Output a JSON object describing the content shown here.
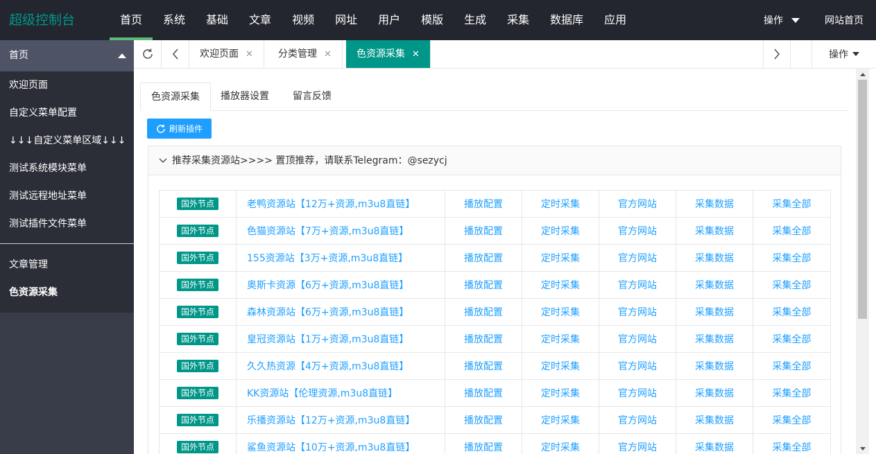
{
  "header": {
    "logo": "超级控制台",
    "nav": [
      "首页",
      "系统",
      "基础",
      "文章",
      "视频",
      "网址",
      "用户",
      "模版",
      "生成",
      "采集",
      "数据库",
      "应用"
    ],
    "active_nav": "首页",
    "ops_label": "操作",
    "home_link": "网站首页"
  },
  "sidebar": {
    "group_title": "首页",
    "items": [
      "欢迎页面",
      "自定义菜单配置",
      "↓↓↓自定义菜单区域↓↓↓",
      "测试系统模块菜单",
      "测试远程地址菜单",
      "测试插件文件菜单"
    ],
    "items2": [
      "文章管理",
      "色资源采集"
    ]
  },
  "tabbar": {
    "tabs": [
      "欢迎页面",
      "分类管理",
      "色资源采集"
    ],
    "active_tab": "色资源采集",
    "ops_label": "操作"
  },
  "content": {
    "subtabs": [
      "色资源采集",
      "播放器设置",
      "留言反馈"
    ],
    "refresh_label": "刷新插件",
    "panel_title": "推荐采集资源站>>>>  置顶推荐，请联系Telegram：@sezycj",
    "actions": [
      "播放配置",
      "定时采集",
      "官方网站",
      "采集数据",
      "采集全部"
    ],
    "rows": [
      {
        "badge": "国外节点",
        "name": "老鸭资源站【12万+资源,m3u8直链】"
      },
      {
        "badge": "国外节点",
        "name": "色猫资源站【7万+资源,m3u8直链】"
      },
      {
        "badge": "国外节点",
        "name": "155资源站【3万+资源,m3u8直链】"
      },
      {
        "badge": "国外节点",
        "name": "奥斯卡资源【6万+资源,m3u8直链】"
      },
      {
        "badge": "国外节点",
        "name": "森林资源站【6万+资源,m3u8直链】"
      },
      {
        "badge": "国外节点",
        "name": "皇冠资源站【1万+资源,m3u8直链】"
      },
      {
        "badge": "国外节点",
        "name": "久久热资源【4万+资源,m3u8直链】"
      },
      {
        "badge": "国外节点",
        "name": "KK资源站【伦理资源,m3u8直链】"
      },
      {
        "badge": "国外节点",
        "name": "乐播资源站【12万+资源,m3u8直链】"
      },
      {
        "badge": "国外节点",
        "name": "鲨鱼资源站【10万+资源,m3u8直链】"
      }
    ]
  },
  "colors": {
    "header_bg": "#23262e",
    "sidebar_bg": "#393d49",
    "accent": "#009688",
    "link": "#1e9fff",
    "nav_underline": "#5fb878"
  },
  "icons": [
    "refresh-icon",
    "chevron-left-icon",
    "chevron-right-icon",
    "close-icon",
    "caret-down-icon",
    "caret-up-icon",
    "chevron-down-icon"
  ]
}
